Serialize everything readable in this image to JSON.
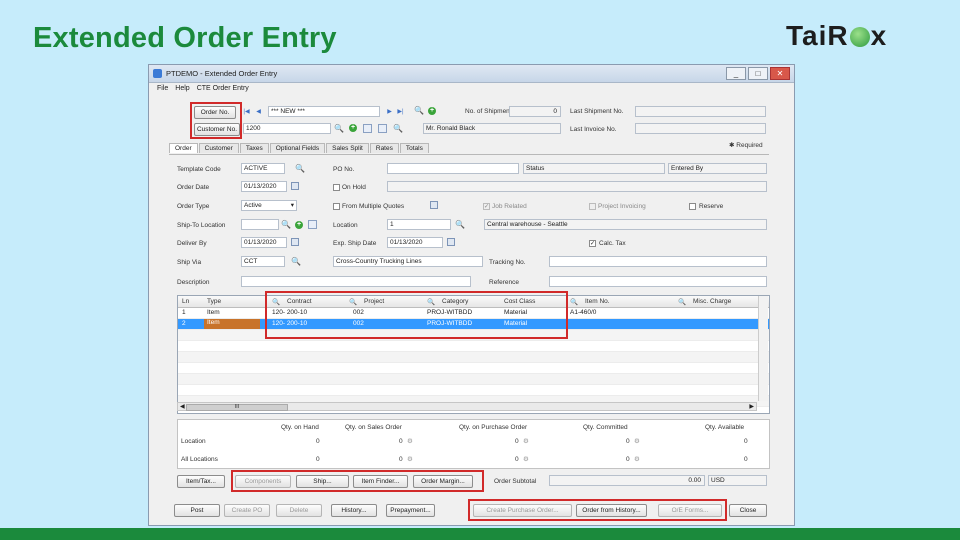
{
  "slide": {
    "title": "Extended Order Entry",
    "logo": {
      "part1": "Tai",
      "part2": "R",
      "part3": "x"
    }
  },
  "window": {
    "title": "PTDEMO - Extended Order Entry",
    "menu": [
      "File",
      "Help",
      "CTE Order Entry"
    ],
    "controls": [
      "_",
      "□",
      "✕"
    ]
  },
  "header": {
    "order_no_button": "Order No.",
    "order_no_value": "*** NEW ***",
    "customer_no_button": "Customer No.",
    "customer_no_value": "1200",
    "customer_name": "Mr. Ronald Black",
    "no_of_shipments_label": "No. of Shipments",
    "no_of_shipments_value": "0",
    "last_shipment_label": "Last Shipment No.",
    "last_invoice_label": "Last Invoice No.",
    "required_label": "Required"
  },
  "tabs": [
    "Order",
    "Customer",
    "Taxes",
    "Optional Fields",
    "Sales Split",
    "Rates",
    "Totals"
  ],
  "order_tab": {
    "template_code_label": "Template Code",
    "template_code_value": "ACTIVE",
    "po_no_label": "PO No.",
    "status_label": "Status",
    "entered_by_label": "Entered By",
    "order_date_label": "Order Date",
    "order_date_value": "01/13/2020",
    "on_hold_label": "On Hold",
    "order_type_label": "Order Type",
    "order_type_value": "Active",
    "from_multiple_quotes_label": "From Multiple Quotes",
    "job_related_label": "Job Related",
    "project_invoicing_label": "Project Invoicing",
    "reserve_label": "Reserve",
    "ship_to_location_label": "Ship-To Location",
    "location_label": "Location",
    "location_value": "1",
    "location_desc": "Central warehouse - Seattle",
    "deliver_by_label": "Deliver By",
    "deliver_by_value": "01/13/2020",
    "exp_ship_date_label": "Exp. Ship Date",
    "exp_ship_date_value": "01/13/2020",
    "calc_tax_label": "Calc. Tax",
    "ship_via_label": "Ship Via",
    "ship_via_value": "CCT",
    "ship_via_desc": "Cross-Country Trucking Lines",
    "tracking_no_label": "Tracking No.",
    "description_label": "Description",
    "reference_label": "Reference"
  },
  "grid": {
    "columns": [
      "Ln",
      "Type",
      "Contract",
      "Project",
      "Category",
      "Cost Class",
      "Item No.",
      "Misc. Charge"
    ],
    "rows": [
      [
        "1",
        "Item",
        "120- 200-10",
        "002",
        "PROJ-WITBDD",
        "Material",
        "A1-460/0",
        ""
      ],
      [
        "2",
        "Item",
        "120- 200-10",
        "002",
        "PROJ-WITBDD",
        "Material",
        "",
        ""
      ]
    ],
    "scroll_label": "III"
  },
  "availability": {
    "columns": [
      "Qty. on Hand",
      "Qty. on Sales Order",
      "Qty. on Purchase Order",
      "Qty. Committed",
      "Qty. Available"
    ],
    "rows": [
      {
        "label": "Location",
        "values": [
          "0",
          "0",
          "0",
          "0",
          "0"
        ]
      },
      {
        "label": "All Locations",
        "values": [
          "0",
          "0",
          "0",
          "0",
          "0"
        ]
      }
    ]
  },
  "buttons_row1": [
    "Item/Tax...",
    "Components",
    "Ship...",
    "Item Finder...",
    "Order Margin..."
  ],
  "order_subtotal_label": "Order Subtotal",
  "order_subtotal_value": "0.00",
  "currency": "USD",
  "buttons_row2": [
    "Post",
    "Create PO",
    "Delete",
    "History...",
    "Prepayment...",
    "Create Purchase Order...",
    "Order from History...",
    "O/E Forms...",
    "Close"
  ],
  "colors": {
    "accent_green": "#1b8a3c",
    "highlight_red": "#d12a2a",
    "selected_row": "#3399ff"
  }
}
